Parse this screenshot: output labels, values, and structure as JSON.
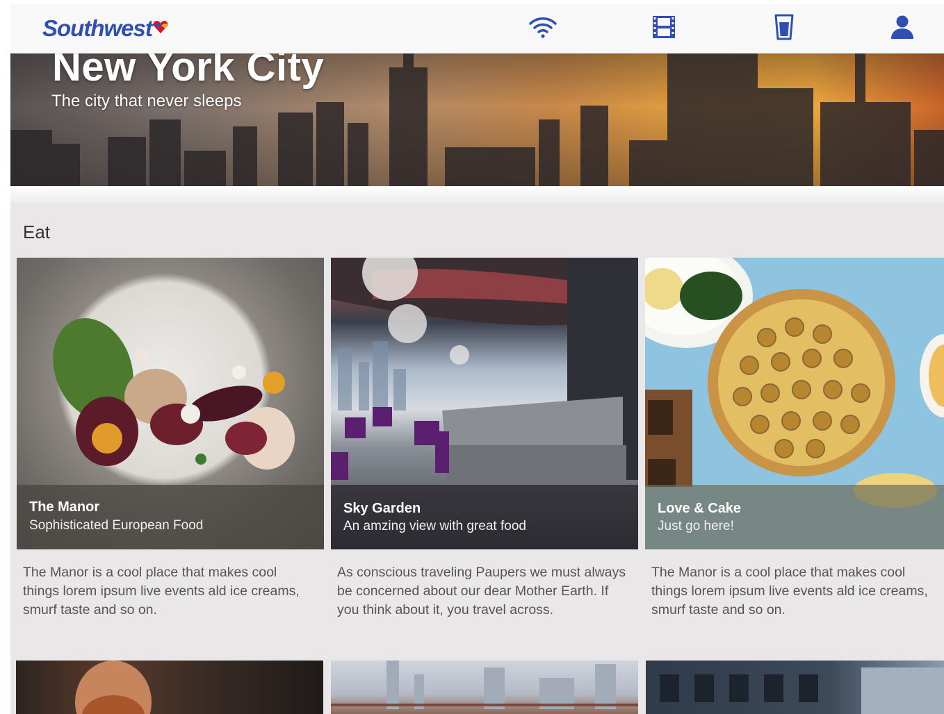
{
  "header": {
    "brand": "Southwest",
    "icons": [
      "wifi-icon",
      "movie-icon",
      "drink-icon",
      "profile-icon"
    ],
    "brand_color": "#2f4fb2"
  },
  "hero": {
    "title": "New York City",
    "subtitle": "The city that never sleeps"
  },
  "section": {
    "title": "Eat"
  },
  "cards": [
    {
      "name": "The Manor",
      "tagline": "Sophisticated European Food",
      "description": "The Manor is a cool place that makes cool things lorem ipsum live events ald ice creams, smurf taste and so on."
    },
    {
      "name": "Sky Garden",
      "tagline": "An amzing view with great food",
      "description": "As conscious traveling Paupers we must always be concerned about our dear Mother Earth. If you think about it, you travel across."
    },
    {
      "name": "Love & Cake",
      "tagline": "Just go here!",
      "description": "The Manor is a cool place that makes cool things lorem ipsum live events ald ice creams, smurf taste and so on."
    }
  ]
}
